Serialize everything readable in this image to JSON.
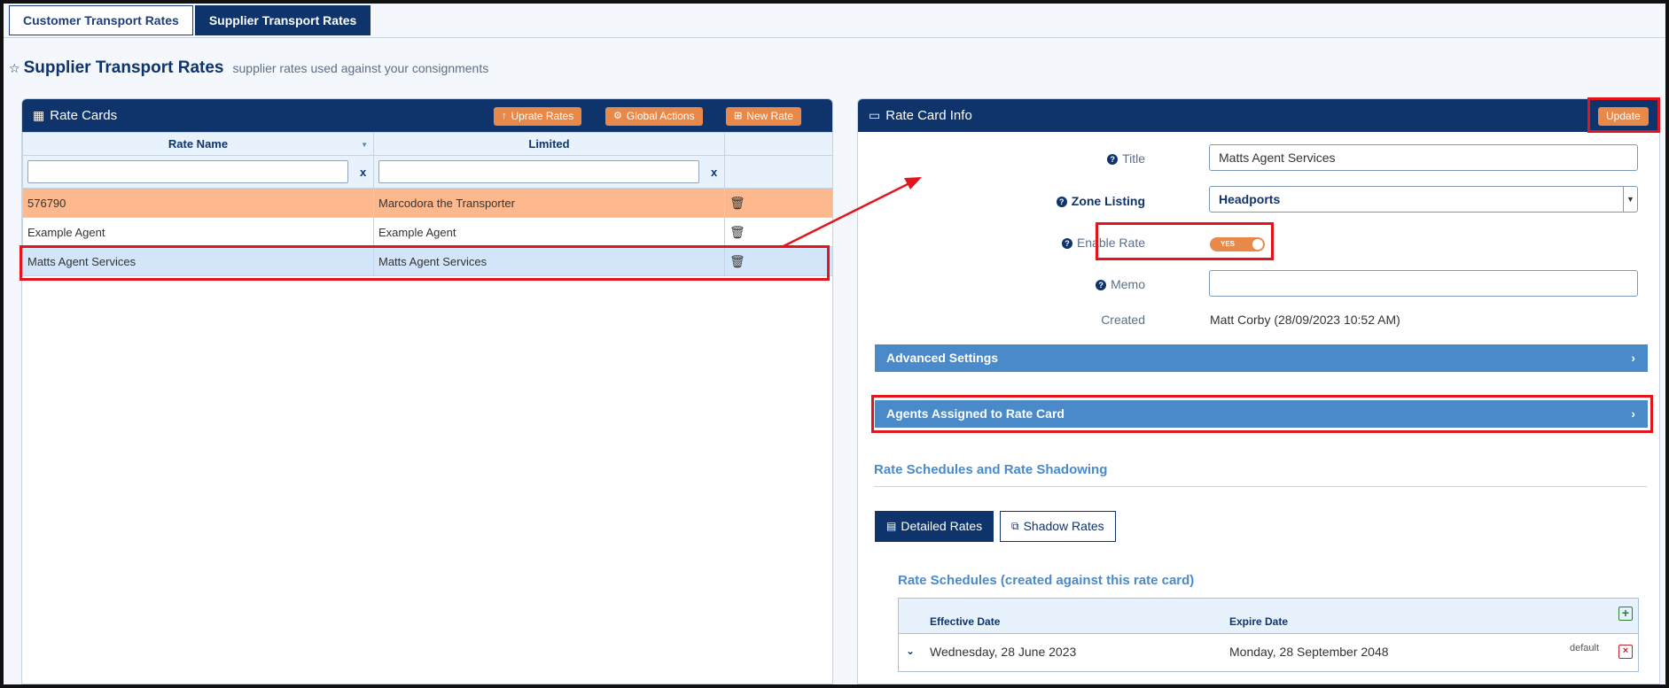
{
  "tabs": [
    {
      "label": "Customer Transport Rates",
      "active": false
    },
    {
      "label": "Supplier Transport Rates",
      "active": true
    }
  ],
  "page": {
    "title": "Supplier Transport Rates",
    "subtitle": "supplier rates used against your consignments"
  },
  "rate_cards": {
    "title": "Rate Cards",
    "buttons": {
      "uprate": "Uprate Rates",
      "global": "Global Actions",
      "new_rate": "New Rate"
    },
    "columns": [
      "Rate Name",
      "Limited"
    ],
    "filter_clear": "x",
    "rows": [
      {
        "name": "576790",
        "limited": "Marcodora the Transporter",
        "style": "orange"
      },
      {
        "name": "Example Agent",
        "limited": "Example Agent",
        "style": "normal"
      },
      {
        "name": "Matts Agent Services",
        "limited": "Matts Agent Services",
        "style": "selected"
      }
    ]
  },
  "rate_card_info": {
    "title": "Rate Card Info",
    "update_label": "Update",
    "fields": {
      "title_label": "Title",
      "title_value": "Matts Agent Services",
      "zone_label": "Zone Listing",
      "zone_value": "Headports",
      "enable_label": "Enable Rate",
      "enable_value": "YES",
      "memo_label": "Memo",
      "memo_value": "",
      "created_label": "Created",
      "created_value": "Matt Corby (28/09/2023 10:52 AM)"
    },
    "advanced_settings": "Advanced Settings",
    "agents_assigned": "Agents Assigned to Rate Card",
    "schedules_section": "Rate Schedules and Rate Shadowing",
    "subtabs": {
      "detailed": "Detailed Rates",
      "shadow": "Shadow Rates"
    },
    "schedules_title": "Rate Schedules (created against this rate card)",
    "schedule_columns": {
      "effective": "Effective Date",
      "expire": "Expire Date"
    },
    "schedule_rows": [
      {
        "effective": "Wednesday, 28 June 2023",
        "expire": "Monday, 28 September 2048",
        "tag": "default"
      }
    ]
  },
  "colors": {
    "navy": "#0e346b",
    "orange": "#e8894a",
    "accent_blue": "#4a8ac9",
    "highlight_red": "#e4141c"
  }
}
